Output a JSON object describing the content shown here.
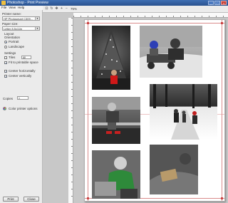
{
  "window": {
    "title": "Photoshop - Print Preview"
  },
  "menu": {
    "items": [
      "File",
      "View",
      "Help"
    ]
  },
  "panel": {
    "printer_name_label": "Printer name:",
    "printer_name_value": "HP Photosmart C309...",
    "paper_size_label": "Paper size:",
    "paper_size_value": "Letter 8.5x11in",
    "layout_label": "Layout",
    "orientation_label": "Orientation",
    "portrait_label": "Portrait",
    "landscape_label": "Landscape",
    "settings_label": "Settings",
    "tiles_label": "Tiles",
    "tiles_value": "All",
    "fit_label": "Fit to printable space",
    "center_h_label": "Center horizontally",
    "center_v_label": "Center vertically",
    "copies_label": "Copies",
    "copies_value": "1",
    "color_label": "Color printer options",
    "print_button": "Print",
    "close_button": "Close"
  },
  "toolbar": {
    "zoom": "75%"
  }
}
